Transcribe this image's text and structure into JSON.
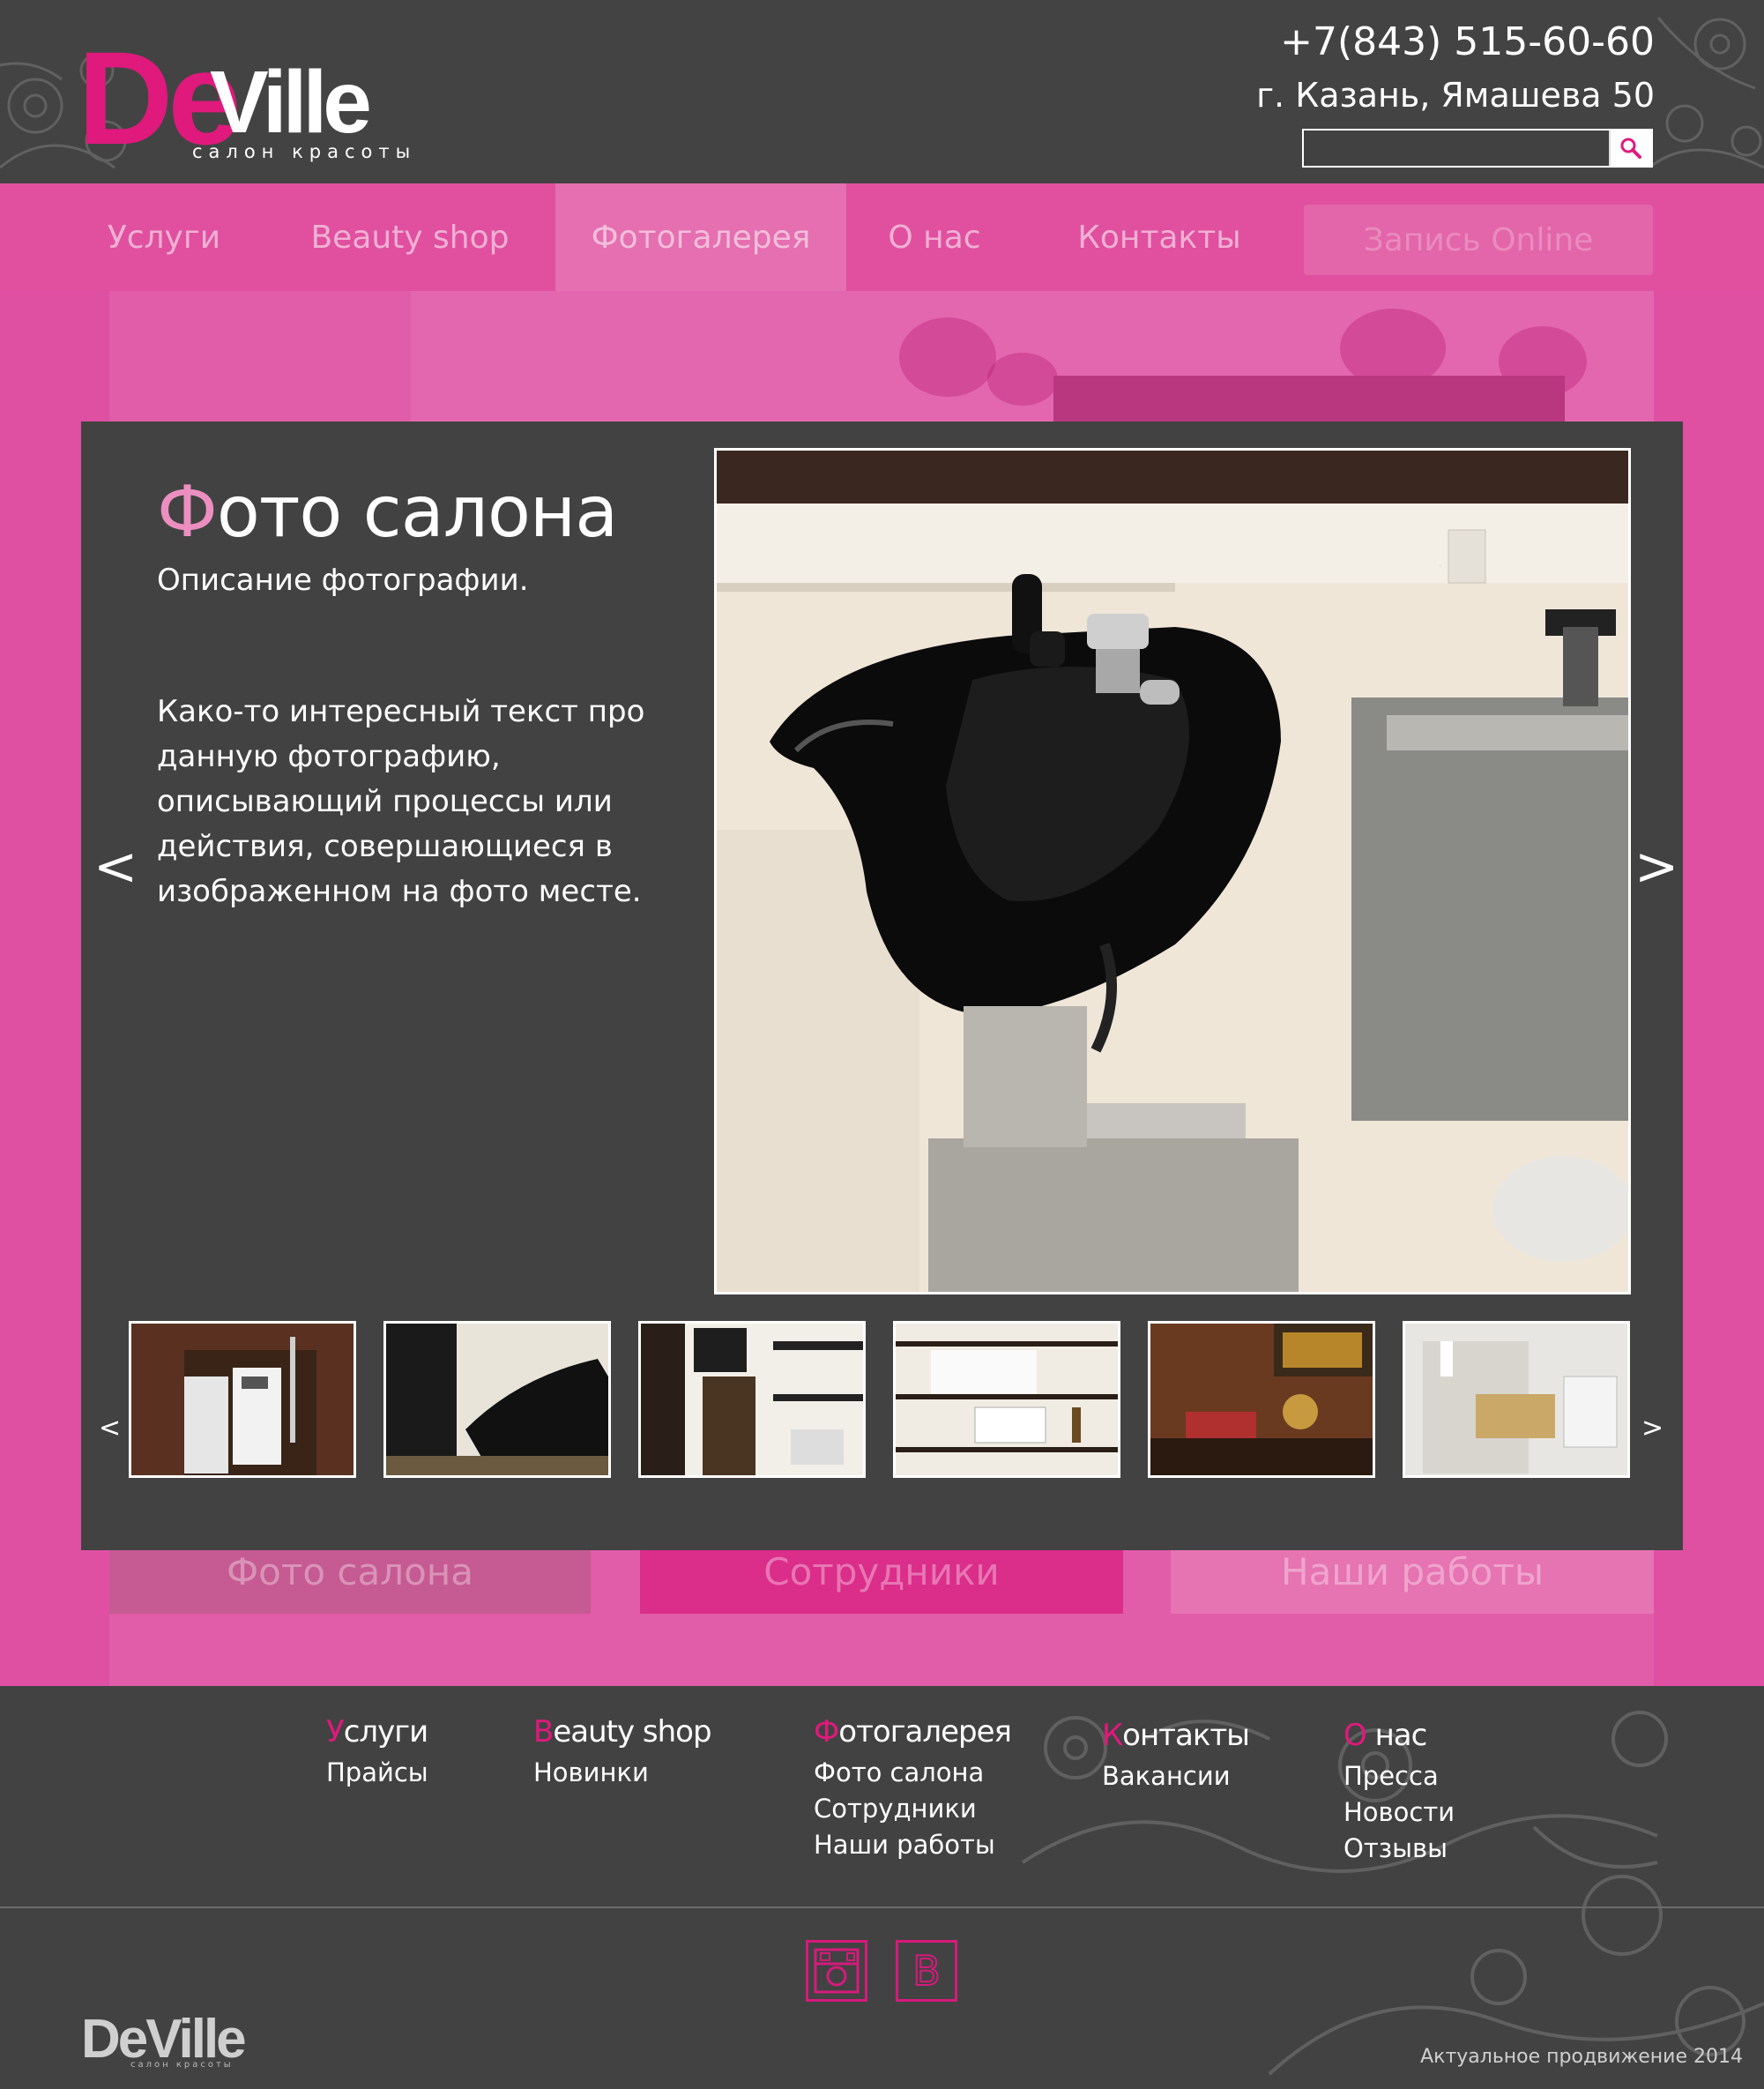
{
  "brand": {
    "logo_first": "De",
    "logo_rest": "Ville",
    "tagline": "салон красоты"
  },
  "contact": {
    "phone": "+7(843) 515-60-60",
    "address": "г. Казань, Ямашева 50"
  },
  "search": {
    "placeholder": ""
  },
  "nav": {
    "items": [
      {
        "label": "Услуги"
      },
      {
        "label": "Beauty shop"
      },
      {
        "label": "Фотогалерея"
      },
      {
        "label": "О нас"
      },
      {
        "label": "Контакты"
      }
    ],
    "cta": "Запись Online"
  },
  "gallery_tabs": [
    "Фото салона",
    "Сотрудники",
    "Наши работы"
  ],
  "modal": {
    "title_first": "Ф",
    "title_rest": "ото салона",
    "description": "Описание фотографии.",
    "body": "Како-то интересный текст про данную фотографию, описывающий процессы или действия, совершающиеся в изображенном на фото месте.",
    "prev": "<",
    "next": ">"
  },
  "footer": {
    "columns": [
      {
        "first": "У",
        "rest": "слуги",
        "links": [
          "Прайсы"
        ]
      },
      {
        "first": "B",
        "rest": "eauty shop",
        "links": [
          "Новинки"
        ]
      },
      {
        "first": "Ф",
        "rest": "отогалерея",
        "links": [
          "Фото салона",
          "Сотрудники",
          "Наши работы"
        ]
      },
      {
        "first": "К",
        "rest": "онтакты",
        "links": [
          "Вакансии"
        ]
      },
      {
        "first": "О",
        "rest": " нас",
        "links": [
          "Пресса",
          "Новости",
          "Отзывы"
        ]
      }
    ],
    "social_vk": "В",
    "copyright": "Актуальное продвижение 2014"
  },
  "colors": {
    "brand_pink": "#e0197d",
    "nav_pink": "#e0509f",
    "dark_bg": "#424242"
  },
  "icons": [
    "search-icon",
    "instagram-icon",
    "vk-icon",
    "arrow-left-icon",
    "arrow-right-icon"
  ]
}
